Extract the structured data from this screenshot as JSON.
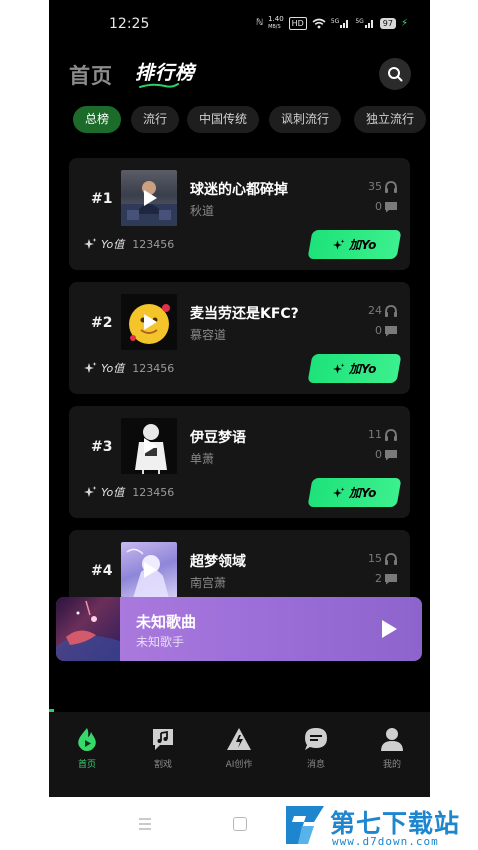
{
  "status_bar": {
    "time": "12:25",
    "nfc": "ℕ",
    "speed_value": "1.40",
    "speed_unit": "MB/S",
    "hd": "HD",
    "signal1": "5G",
    "signal2": "5G",
    "battery": "97"
  },
  "header": {
    "tab_home": "首页",
    "tab_rank": "排行榜",
    "accent_color": "#2bd06a"
  },
  "categories": [
    "总榜",
    "流行",
    "中国传统",
    "讽刺流行",
    "独立流行"
  ],
  "songs": [
    {
      "rank": "#1",
      "title": "球迷的心都碎掉",
      "artist": "秋道",
      "listens": "35",
      "comments": "0",
      "yo_label": "Yo值",
      "yo_score": "123456",
      "add_label": "加Yo"
    },
    {
      "rank": "#2",
      "title": "麦当劳还是KFC?",
      "artist": "慕容道",
      "listens": "24",
      "comments": "0",
      "yo_label": "Yo值",
      "yo_score": "123456",
      "add_label": "加Yo"
    },
    {
      "rank": "#3",
      "title": "伊豆梦语",
      "artist": "单萧",
      "listens": "11",
      "comments": "0",
      "yo_label": "Yo值",
      "yo_score": "123456",
      "add_label": "加Yo"
    },
    {
      "rank": "#4",
      "title": "超梦领域",
      "artist": "南宫萧",
      "listens": "15",
      "comments": "2"
    }
  ],
  "mini_player": {
    "title": "未知歌曲",
    "artist": "未知歌手"
  },
  "bottom_nav": [
    {
      "label": "首页",
      "icon": "home-flame-icon"
    },
    {
      "label": "割戏",
      "icon": "chat-music-icon"
    },
    {
      "label": "AI创作",
      "icon": "ai-create-icon"
    },
    {
      "label": "消息",
      "icon": "message-icon"
    },
    {
      "label": "我的",
      "icon": "profile-icon"
    }
  ],
  "watermark": {
    "main": "第七下载站",
    "sub": "www.d7down.com"
  }
}
